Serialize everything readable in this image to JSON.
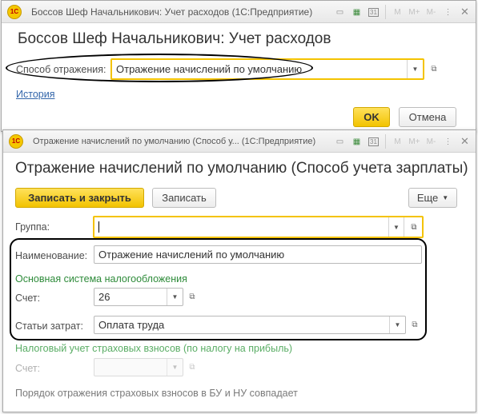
{
  "window1": {
    "title": "Боссов Шеф Начальникович: Учет расходов  (1С:Предприятие)",
    "heading": "Боссов Шеф Начальникович: Учет расходов",
    "method_label": "Способ отражения:",
    "method_value": "Отражение начислений по умолчанию",
    "history_link": "История",
    "ok_label": "OK",
    "cancel_label": "Отмена",
    "toolbar": {
      "m": "M",
      "m_plus": "M+",
      "m_minus": "M-",
      "calendar_day": "31"
    }
  },
  "window2": {
    "title": "Отражение начислений по умолчанию (Способ у...  (1С:Предприятие)",
    "heading": "Отражение начислений по умолчанию (Способ учета зарплаты)",
    "save_close_label": "Записать и закрыть",
    "save_label": "Записать",
    "more_label": "Еще",
    "group_label": "Группа:",
    "group_value": "",
    "name_label": "Наименование:",
    "name_value": "Отражение начислений по умолчанию",
    "tax_system_title": "Основная система налогообложения",
    "account_label": "Счет:",
    "account_value": "26",
    "cost_label": "Статьи затрат:",
    "cost_value": "Оплата труда",
    "insurance_title": "Налоговый учет страховых взносов (по налогу на прибыль)",
    "account2_label": "Счет:",
    "account2_value": "",
    "note": "Порядок отражения страховых взносов в БУ и НУ совпадает",
    "toolbar": {
      "m": "M",
      "m_plus": "M+",
      "m_minus": "M-",
      "calendar_day": "31"
    }
  },
  "colors": {
    "accent_yellow": "#f4c300",
    "link": "#3366aa",
    "group_green": "#2e8b3a"
  },
  "icons": [
    "logo-1c-icon",
    "printer-icon",
    "calculator-icon",
    "calendar-icon",
    "dropdown-arrow-icon",
    "open-form-icon",
    "close-icon"
  ]
}
